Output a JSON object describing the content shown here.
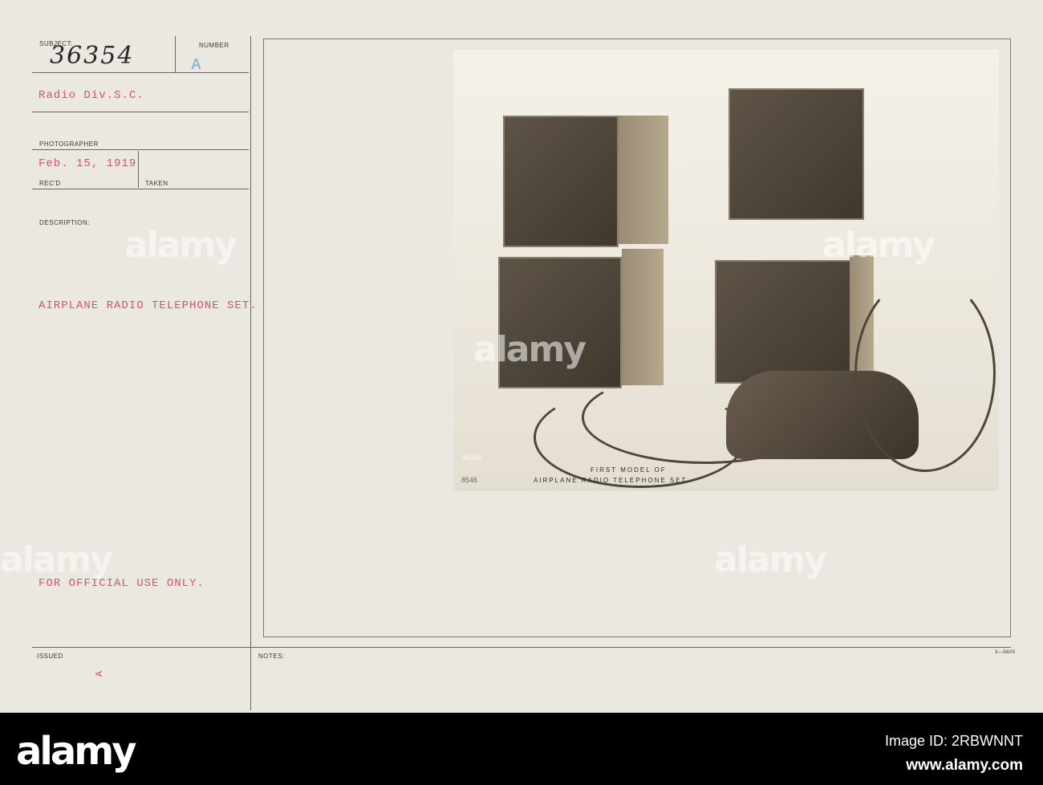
{
  "card": {
    "subject_label": "SUBJECT:",
    "subject_number_handwritten": "36354",
    "number_label": "NUMBER",
    "number_stamp": "A",
    "subject": "Radio Div.S.C.",
    "photographer_label": "PHOTOGRAPHER",
    "date": "Feb. 15, 1919",
    "recd_label": "REC'D",
    "taken_label": "TAKEN",
    "description_label": "DESCRIPTION:",
    "description": "AIRPLANE RADIO TELEPHONE SET.",
    "restriction": "FOR OFFICIAL USE ONLY.",
    "issued_label": "ISSUED",
    "issued_mark": "A",
    "notes_label": "NOTES:",
    "form_number": "3—5605"
  },
  "photo": {
    "negative_number": "36354",
    "plate_number": "8546",
    "caption_line1": "FIRST MODEL OF",
    "caption_line2": "AIRPLANE RADIO TELEPHONE SET"
  },
  "watermark": {
    "text": "alamy",
    "image_id": "Image ID: 2RBWNNT",
    "site": "www.alamy.com"
  }
}
